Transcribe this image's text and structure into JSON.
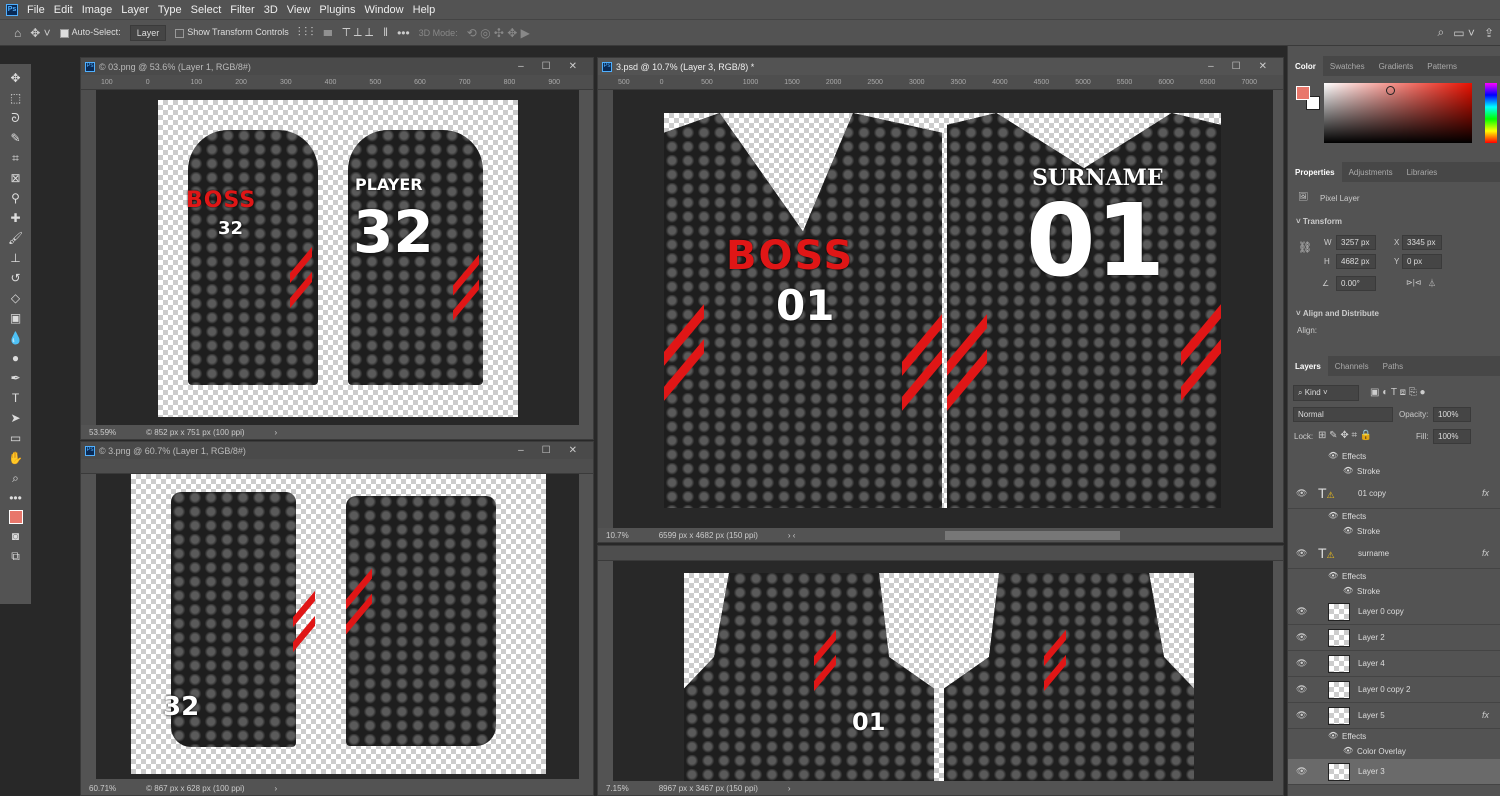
{
  "menu": {
    "app_icon": "Ps",
    "items": [
      "File",
      "Edit",
      "Image",
      "Layer",
      "Type",
      "Select",
      "Filter",
      "3D",
      "View",
      "Plugins",
      "Window",
      "Help"
    ]
  },
  "options": {
    "auto_select_label": "Auto-Select:",
    "auto_select_value": "Layer",
    "show_transform": "Show Transform Controls",
    "mode3d": "3D Mode:"
  },
  "docs": [
    {
      "title": "© 03.png @ 53.6% (Layer 1, RGB/8#)",
      "zoom": "53.59%",
      "info": "© 852 px x 751 px (100 ppi)",
      "ruler": [
        "100",
        "0",
        "100",
        "200",
        "300",
        "400",
        "500",
        "600",
        "700",
        "800",
        "900"
      ]
    },
    {
      "title": "© 3.png @ 60.7% (Layer 1, RGB/8#)",
      "zoom": "60.71%",
      "info": "© 867 px x 628 px (100 ppi)"
    },
    {
      "title": "3.psd @ 10.7% (Layer 3, RGB/8) *",
      "zoom": "10.7%",
      "info": "6599 px x 4682 px (150 ppi)",
      "ruler": [
        "500",
        "0",
        "500",
        "1000",
        "1500",
        "2000",
        "2500",
        "3000",
        "3500",
        "4000",
        "4500",
        "5000",
        "5500",
        "6000",
        "6500",
        "7000"
      ]
    },
    {
      "zoom": "7.15%",
      "info": "8967 px x 3467 px (150 ppi)"
    }
  ],
  "art": {
    "brand": "BOSS",
    "num_small": "32",
    "player": "PLAYER",
    "surname": "SURNAME",
    "num_main": "01",
    "num_shorts": "32"
  },
  "color_panel": {
    "tabs": [
      "Color",
      "Swatches",
      "Gradients",
      "Patterns"
    ],
    "fg": "#e8776b",
    "bg": "#ffffff"
  },
  "properties": {
    "tabs": [
      "Properties",
      "Adjustments",
      "Libraries"
    ],
    "kind": "Pixel Layer",
    "transform": "Transform",
    "w": "3257 px",
    "h": "4682 px",
    "x": "3345 px",
    "y": "0 px",
    "angle": "0.00°",
    "align_title": "Align and Distribute",
    "align_label": "Align:"
  },
  "layers_panel": {
    "tabs": [
      "Layers",
      "Channels",
      "Paths"
    ],
    "filter": "Kind",
    "blend": "Normal",
    "opacity_label": "Opacity:",
    "opacity": "100%",
    "lock_label": "Lock:",
    "fill_label": "Fill:",
    "fill": "100%",
    "rows": [
      {
        "label": "Effects",
        "type": "sub"
      },
      {
        "label": "Stroke",
        "type": "sub2"
      },
      {
        "label": "01 copy",
        "type": "text",
        "fx": "fx"
      },
      {
        "label": "Effects",
        "type": "sub"
      },
      {
        "label": "Stroke",
        "type": "sub2"
      },
      {
        "label": "surname",
        "type": "text",
        "fx": "fx"
      },
      {
        "label": "Effects",
        "type": "sub"
      },
      {
        "label": "Stroke",
        "type": "sub2"
      },
      {
        "label": "Layer 0 copy",
        "type": "layer"
      },
      {
        "label": "Layer 2",
        "type": "layer"
      },
      {
        "label": "Layer 4",
        "type": "layer"
      },
      {
        "label": "Layer 0 copy 2",
        "type": "layer"
      },
      {
        "label": "Layer 5",
        "type": "layer",
        "fx": "fx"
      },
      {
        "label": "Effects",
        "type": "sub"
      },
      {
        "label": "Color Overlay",
        "type": "sub2"
      },
      {
        "label": "Layer 3",
        "type": "layer"
      }
    ]
  }
}
